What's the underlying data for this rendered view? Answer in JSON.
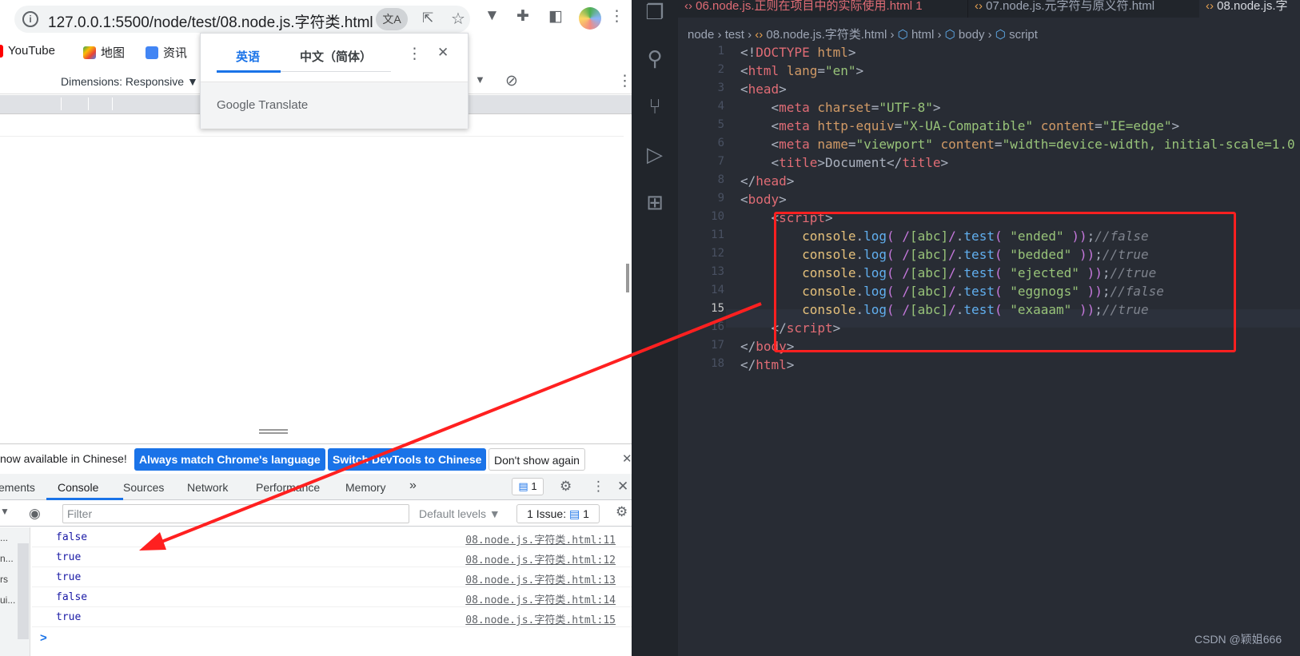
{
  "browser": {
    "url": "127.0.0.1:5500/node/test/08.node.js.字符类.html",
    "bookmarks": [
      "YouTube",
      "地图",
      "资讯"
    ],
    "device_toolbar": {
      "dimensions_label": "Dimensions: Responsive"
    },
    "translate_popup": {
      "tab_english": "英语",
      "tab_chinese": "中文（简体）",
      "footer": "Google Translate"
    },
    "language_bar": {
      "message": "now available in Chinese!",
      "always_match": "Always match Chrome's language",
      "switch_devtools": "Switch DevTools to Chinese",
      "dont_show": "Don't show again"
    },
    "devtools": {
      "tabs": [
        "ements",
        "Console",
        "Sources",
        "Network",
        "Performance",
        "Memory",
        "»"
      ],
      "message_count": "1",
      "filter_placeholder": "Filter",
      "levels_label": "Default levels",
      "issues_label": "1 Issue:",
      "issues_count": "1",
      "side_items": [
        "...",
        "n...",
        "rs",
        "ui..."
      ],
      "console_rows": [
        {
          "value": "false",
          "source": "08.node.js.字符类.html:11"
        },
        {
          "value": "true",
          "source": "08.node.js.字符类.html:12"
        },
        {
          "value": "true",
          "source": "08.node.js.字符类.html:13"
        },
        {
          "value": "false",
          "source": "08.node.js.字符类.html:14"
        },
        {
          "value": "true",
          "source": "08.node.js.字符类.html:15"
        }
      ],
      "prompt": ">"
    }
  },
  "vscode": {
    "tabs": [
      {
        "label": "06.node.js.正则在项目中的实际使用.html 1",
        "color": "#e06c75"
      },
      {
        "label": "07.node.js.元字符与原义符.html",
        "color": "#9da5b4"
      },
      {
        "label": "08.node.js.字",
        "color": "#d7dae0"
      }
    ],
    "breadcrumbs": [
      "node",
      "test",
      "08.node.js.字符类.html",
      "html",
      "body",
      "script"
    ],
    "current_line": "15",
    "watermark": "CSDN @颖姐666"
  },
  "colors": {
    "annotation_red": "#ff2020",
    "chrome_blue": "#1a73e8",
    "editor_bg": "#282c34"
  }
}
